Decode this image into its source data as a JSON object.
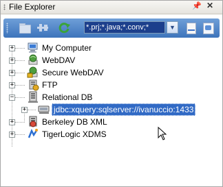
{
  "window": {
    "title": "File Explorer"
  },
  "toolbar": {
    "filter_value": "*.prj;*.java;*.conv;*"
  },
  "tree": {
    "items": [
      {
        "label": "My Computer",
        "icon": "computer-icon"
      },
      {
        "label": "WebDAV",
        "icon": "webdav-icon"
      },
      {
        "label": "Secure WebDAV",
        "icon": "secure-webdav-icon"
      },
      {
        "label": "FTP",
        "icon": "ftp-icon"
      },
      {
        "label": "Relational DB",
        "icon": "database-icon"
      },
      {
        "label": "jdbc:xquery:sqlserver://ivanuccio:1433",
        "icon": "connection-icon",
        "selected": true
      },
      {
        "label": "Berkeley DB XML",
        "icon": "berkeley-db-icon"
      },
      {
        "label": "TigerLogic XDMS",
        "icon": "tigerlogic-icon"
      }
    ]
  },
  "colors": {
    "toolbar": "#4a7fc4",
    "selection": "#316ac5"
  }
}
